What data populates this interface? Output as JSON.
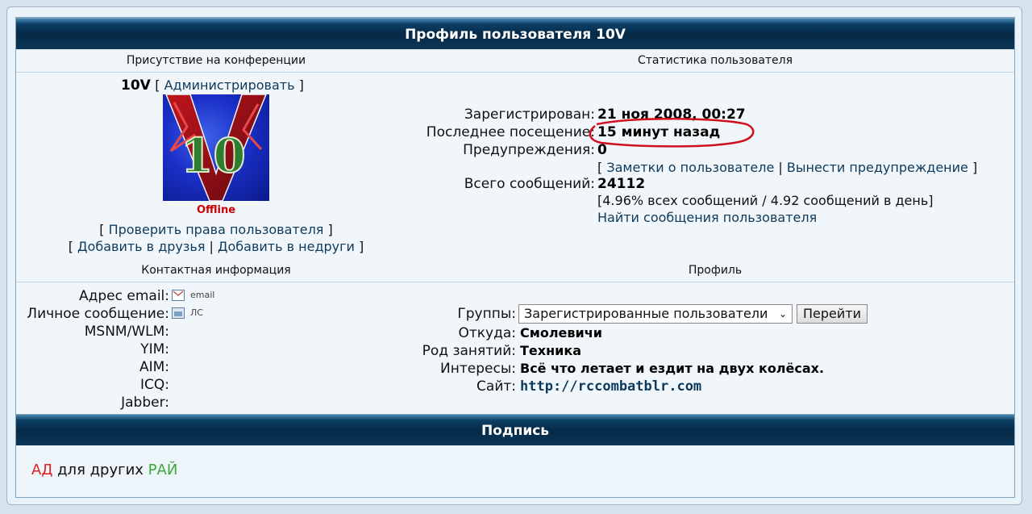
{
  "header": {
    "title": "Профиль пользователя 10V"
  },
  "presence": {
    "heading": "Присутствие на конференции",
    "username": "10V",
    "admin_link": "Администрировать",
    "status": "Offline",
    "check_rights": "Проверить права пользователя",
    "add_friend": "Добавить в друзья",
    "add_foe": "Добавить в недруги"
  },
  "stats": {
    "heading": "Статистика пользователя",
    "registered_label": "Зарегистрирован:",
    "registered_value": "21 ноя 2008, 00:27",
    "last_visit_label": "Последнее посещение:",
    "last_visit_value": "15 минут назад",
    "warnings_label": "Предупреждения:",
    "warnings_value": "0",
    "notes_link": "Заметки о пользователе",
    "warn_link": "Вынести предупреждение",
    "posts_label": "Всего сообщений:",
    "posts_value": "24112",
    "posts_detail": "[4.96% всех сообщений / 4.92 сообщений в день]",
    "find_posts": "Найти сообщения пользователя"
  },
  "contact": {
    "heading": "Контактная информация",
    "email_label": "Адрес email:",
    "email_icon_text": "email",
    "pm_label": "Личное сообщение:",
    "pm_icon_text": "ЛС",
    "msn_label": "MSNM/WLM:",
    "yim_label": "YIM:",
    "aim_label": "AIM:",
    "icq_label": "ICQ:",
    "jabber_label": "Jabber:"
  },
  "profile": {
    "heading": "Профиль",
    "groups_label": "Группы:",
    "groups_selected": "Зарегистрированные пользователи",
    "go_button": "Перейти",
    "from_label": "Откуда:",
    "from_value": "Смолевичи",
    "occupation_label": "Род занятий:",
    "occupation_value": "Техника",
    "interests_label": "Интересы:",
    "interests_value": "Всё что летает и ездит на двух колёсах.",
    "site_label": "Сайт:",
    "site_value": "http://rccombatblr.com"
  },
  "signature": {
    "heading": "Подпись",
    "part1": "АД",
    "part2": " для других ",
    "part3": "РАЙ"
  },
  "colors": {
    "header_bg": "#062a47",
    "link": "#0d3a5c",
    "offline": "#cc0000",
    "sig_red": "#e02020",
    "sig_green": "#3aa83a",
    "annotation": "#d0101e"
  }
}
